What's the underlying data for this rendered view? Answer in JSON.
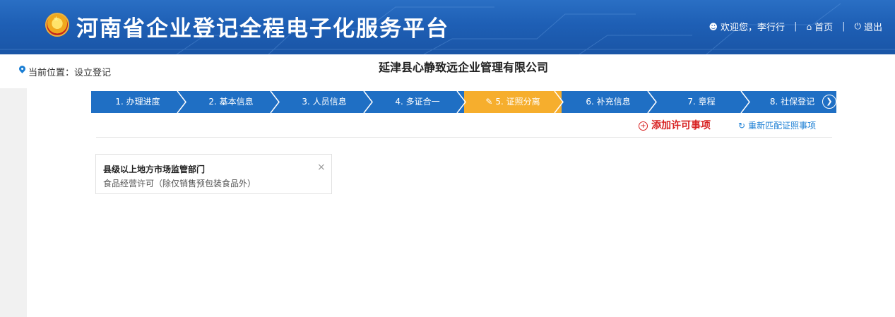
{
  "header": {
    "title": "河南省企业登记全程电子化服务平台",
    "welcome": "欢迎您，李行行",
    "home_label": "首页",
    "logout_label": "退出",
    "brand_color": "#1e5fb5"
  },
  "location": {
    "label": "当前位置：设立登记",
    "company_name": "延津县心静致远企业管理有限公司"
  },
  "steps": {
    "items": [
      "1. 办理进度",
      "2. 基本信息",
      "3. 人员信息",
      "4. 多证合一",
      "5. 证照分离",
      "6. 补充信息",
      "7. 章程",
      "8. 社保登记"
    ],
    "active_index": 4,
    "step_color": "#1f6fc4",
    "active_color": "#f6ae2d"
  },
  "actions": {
    "add_label": "添加许可事项",
    "rematch_label": "重新匹配证照事项",
    "add_color": "#d71f1f",
    "link_color": "#1a7ed4"
  },
  "license_card": {
    "department": "县级以上地方市场监管部门",
    "item": "食品经营许可（除仅销售预包装食品外）",
    "close": "×"
  }
}
